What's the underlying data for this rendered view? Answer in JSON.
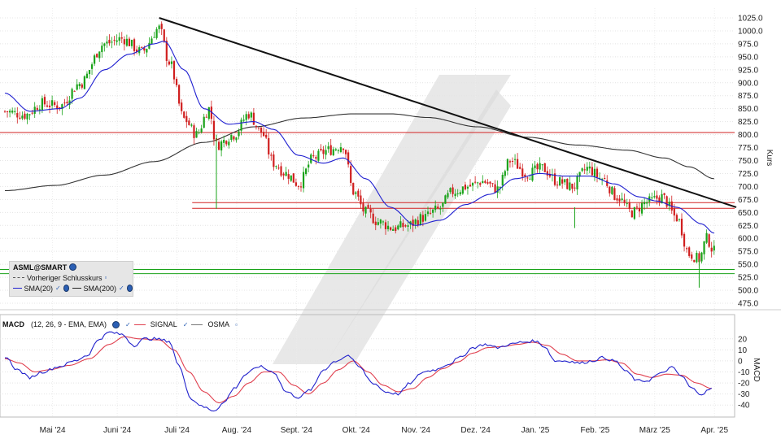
{
  "chart_data": [
    {
      "type": "candlestick",
      "name": "ASML@SMART",
      "ylabel": "Kurs",
      "ylim": [
        475,
        1025
      ],
      "yticks": [
        "1025.0",
        "1000.0",
        "975.0",
        "950.0",
        "925.0",
        "900.0",
        "875.0",
        "850.0",
        "825.0",
        "800.0",
        "775.0",
        "750.0",
        "725.0",
        "700.0",
        "675.0",
        "650.0",
        "625.0",
        "600.0",
        "575.0",
        "550.0",
        "525.0",
        "500.0",
        "475.0"
      ],
      "x_labels": [
        "Mai '24",
        "Juni '24",
        "Juli '24",
        "Aug. '24",
        "Sept. '24",
        "Okt. '24",
        "Nov. '24",
        "Dez. '24",
        "Jan. '25",
        "Feb. '25",
        "März '25",
        "Apr. '25"
      ],
      "legend": {
        "title": "ASML@SMART",
        "items": [
          {
            "label": "Vorheriger Schlusskurs",
            "style": "dashed"
          },
          {
            "label": "SMA(20)",
            "color": "#1f1fd0"
          },
          {
            "label": "SMA(200)",
            "color": "#222222"
          }
        ]
      },
      "anchors": [
        [
          0,
          845
        ],
        [
          8,
          838
        ],
        [
          15,
          860
        ],
        [
          22,
          855
        ],
        [
          30,
          898
        ],
        [
          40,
          975
        ],
        [
          47,
          985
        ],
        [
          55,
          960
        ],
        [
          62,
          1005
        ],
        [
          66,
          940
        ],
        [
          72,
          830
        ],
        [
          77,
          800
        ],
        [
          82,
          850
        ],
        [
          85,
          780
        ],
        [
          92,
          800
        ],
        [
          98,
          840
        ],
        [
          103,
          805
        ],
        [
          108,
          745
        ],
        [
          113,
          725
        ],
        [
          118,
          705
        ],
        [
          124,
          755
        ],
        [
          130,
          770
        ],
        [
          136,
          780
        ],
        [
          140,
          690
        ],
        [
          145,
          650
        ],
        [
          150,
          632
        ],
        [
          156,
          620
        ],
        [
          162,
          625
        ],
        [
          168,
          640
        ],
        [
          174,
          655
        ],
        [
          180,
          690
        ],
        [
          186,
          700
        ],
        [
          192,
          710
        ],
        [
          198,
          695
        ],
        [
          203,
          750
        ],
        [
          210,
          725
        ],
        [
          216,
          735
        ],
        [
          222,
          710
        ],
        [
          228,
          700
        ],
        [
          234,
          735
        ],
        [
          240,
          715
        ],
        [
          246,
          680
        ],
        [
          252,
          650
        ],
        [
          258,
          670
        ],
        [
          264,
          680
        ],
        [
          270,
          640
        ],
        [
          275,
          570
        ],
        [
          279,
          560
        ],
        [
          282,
          600
        ],
        [
          285,
          575
        ]
      ],
      "sma20_anchors": [
        [
          0,
          880
        ],
        [
          10,
          845
        ],
        [
          22,
          850
        ],
        [
          30,
          870
        ],
        [
          40,
          925
        ],
        [
          50,
          955
        ],
        [
          60,
          975
        ],
        [
          64,
          980
        ],
        [
          72,
          925
        ],
        [
          80,
          850
        ],
        [
          90,
          820
        ],
        [
          100,
          825
        ],
        [
          108,
          810
        ],
        [
          118,
          760
        ],
        [
          128,
          745
        ],
        [
          136,
          755
        ],
        [
          145,
          715
        ],
        [
          155,
          660
        ],
        [
          165,
          625
        ],
        [
          175,
          635
        ],
        [
          185,
          665
        ],
        [
          195,
          685
        ],
        [
          205,
          715
        ],
        [
          215,
          725
        ],
        [
          225,
          720
        ],
        [
          235,
          720
        ],
        [
          245,
          705
        ],
        [
          255,
          680
        ],
        [
          262,
          672
        ],
        [
          270,
          660
        ],
        [
          280,
          628
        ],
        [
          285,
          610
        ]
      ],
      "sma200_anchors": [
        [
          0,
          692
        ],
        [
          20,
          702
        ],
        [
          40,
          722
        ],
        [
          60,
          748
        ],
        [
          80,
          785
        ],
        [
          100,
          815
        ],
        [
          120,
          832
        ],
        [
          140,
          840
        ],
        [
          155,
          840
        ],
        [
          170,
          833
        ],
        [
          190,
          815
        ],
        [
          210,
          795
        ],
        [
          230,
          780
        ],
        [
          250,
          770
        ],
        [
          265,
          755
        ],
        [
          275,
          738
        ],
        [
          285,
          715
        ]
      ],
      "trendline": [
        [
          62,
          1025
        ],
        [
          290,
          660
        ]
      ],
      "hlines": [
        {
          "value": 804,
          "color": "#d22222",
          "from": 0
        },
        {
          "value": 669,
          "color": "#d22222",
          "from": 72
        },
        {
          "value": 658,
          "color": "#d22222",
          "from": 72
        },
        {
          "value": 540,
          "color": "#1aa31a",
          "from": 0
        },
        {
          "value": 532,
          "color": "#1aa31a",
          "from": 0
        }
      ]
    },
    {
      "type": "line",
      "name": "MACD",
      "ylabel": "MACD",
      "ylim": [
        -45,
        25
      ],
      "yticks": [
        "20",
        "10",
        "0",
        "-10",
        "-20",
        "-30",
        "-40"
      ],
      "legend": {
        "title": "MACD",
        "items": [
          {
            "label": "(12, 26, 9 - EMA, EMA)",
            "color": "#2222cc"
          },
          {
            "label": "SIGNAL",
            "color": "#e0404f"
          },
          {
            "label": "OSMA",
            "color": "#777777"
          }
        ]
      },
      "macd_anchors": [
        [
          0,
          4
        ],
        [
          5,
          -8
        ],
        [
          10,
          -15
        ],
        [
          15,
          -10
        ],
        [
          22,
          -5
        ],
        [
          28,
          0
        ],
        [
          33,
          5
        ],
        [
          38,
          20
        ],
        [
          42,
          26
        ],
        [
          47,
          24
        ],
        [
          52,
          14
        ],
        [
          56,
          20
        ],
        [
          60,
          20
        ],
        [
          66,
          18
        ],
        [
          70,
          -5
        ],
        [
          75,
          -35
        ],
        [
          80,
          -42
        ],
        [
          84,
          -45
        ],
        [
          88,
          -38
        ],
        [
          92,
          -25
        ],
        [
          97,
          -12
        ],
        [
          102,
          -5
        ],
        [
          108,
          -10
        ],
        [
          113,
          -28
        ],
        [
          118,
          -33
        ],
        [
          123,
          -26
        ],
        [
          128,
          -8
        ],
        [
          133,
          0
        ],
        [
          138,
          5
        ],
        [
          142,
          -5
        ],
        [
          148,
          -20
        ],
        [
          153,
          -28
        ],
        [
          158,
          -30
        ],
        [
          163,
          -20
        ],
        [
          168,
          -10
        ],
        [
          173,
          -8
        ],
        [
          178,
          -3
        ],
        [
          183,
          3
        ],
        [
          188,
          12
        ],
        [
          193,
          15
        ],
        [
          198,
          12
        ],
        [
          203,
          15
        ],
        [
          208,
          17
        ],
        [
          213,
          18
        ],
        [
          217,
          13
        ],
        [
          221,
          0
        ],
        [
          226,
          0
        ],
        [
          231,
          -2
        ],
        [
          236,
          0
        ],
        [
          240,
          3
        ],
        [
          245,
          0
        ],
        [
          250,
          -10
        ],
        [
          254,
          -18
        ],
        [
          258,
          -18
        ],
        [
          263,
          -12
        ],
        [
          268,
          -6
        ],
        [
          272,
          -14
        ],
        [
          276,
          -25
        ],
        [
          280,
          -30
        ],
        [
          284,
          -25
        ]
      ],
      "signal_anchors": [
        [
          0,
          2
        ],
        [
          6,
          -2
        ],
        [
          12,
          -10
        ],
        [
          18,
          -8
        ],
        [
          26,
          -4
        ],
        [
          34,
          2
        ],
        [
          42,
          15
        ],
        [
          48,
          22
        ],
        [
          54,
          20
        ],
        [
          62,
          19
        ],
        [
          68,
          10
        ],
        [
          74,
          -10
        ],
        [
          80,
          -28
        ],
        [
          86,
          -38
        ],
        [
          92,
          -32
        ],
        [
          98,
          -20
        ],
        [
          104,
          -10
        ],
        [
          110,
          -10
        ],
        [
          116,
          -22
        ],
        [
          122,
          -30
        ],
        [
          128,
          -20
        ],
        [
          134,
          -8
        ],
        [
          140,
          0
        ],
        [
          146,
          -10
        ],
        [
          152,
          -22
        ],
        [
          158,
          -28
        ],
        [
          164,
          -25
        ],
        [
          170,
          -15
        ],
        [
          176,
          -7
        ],
        [
          182,
          -1
        ],
        [
          188,
          7
        ],
        [
          194,
          12
        ],
        [
          200,
          13
        ],
        [
          206,
          15
        ],
        [
          212,
          17
        ],
        [
          218,
          14
        ],
        [
          224,
          6
        ],
        [
          230,
          0
        ],
        [
          236,
          0
        ],
        [
          242,
          1
        ],
        [
          248,
          -2
        ],
        [
          254,
          -12
        ],
        [
          260,
          -15
        ],
        [
          266,
          -12
        ],
        [
          272,
          -13
        ],
        [
          278,
          -20
        ],
        [
          284,
          -25
        ]
      ]
    }
  ]
}
